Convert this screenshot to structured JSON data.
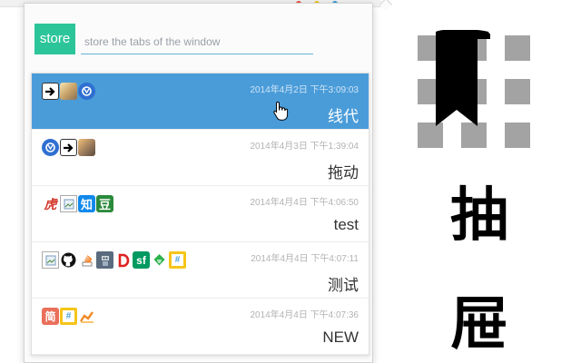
{
  "popup": {
    "store_label": "store",
    "name_placeholder": "store the tabs of the window"
  },
  "tab_groups": [
    {
      "time": "2014年4月2日 下午3:09:03",
      "title": "线代",
      "selected": true
    },
    {
      "time": "2014年4月3日 下午1:39:04",
      "title": "拖动",
      "selected": false
    },
    {
      "time": "2014年4月4日 下午4:06:50",
      "title": "test",
      "selected": false
    },
    {
      "time": "2014年4月4日 下午4:07:11",
      "title": "测试",
      "selected": false
    },
    {
      "time": "2014年4月4日 下午4:07:36",
      "title": "NEW",
      "selected": false
    }
  ],
  "favicons": {
    "row0": [
      "arrow-favicon",
      "anime-favicon",
      "app-favicon"
    ],
    "row1": [
      "app-favicon",
      "arrow-favicon",
      "anime-favicon"
    ],
    "row2": [
      "tiger-favicon",
      "broken-image-favicon",
      "zhihu-favicon",
      "douban-favicon"
    ],
    "row3": [
      "broken-image-favicon",
      "github-favicon",
      "stack-favicon",
      "robot-favicon",
      "d-favicon",
      "segmentfault-favicon",
      "feedly-favicon",
      "hash-favicon"
    ],
    "row4": [
      "jian-favicon",
      "hash-favicon",
      "chart-favicon"
    ]
  },
  "favicon_text": {
    "zhihu": "知",
    "douban": "豆",
    "segmentfault": "sf",
    "jian": "简",
    "tiger": "虎"
  },
  "logo": {
    "char_top": "抽",
    "char_bottom": "屉"
  },
  "colors": {
    "accent_green": "#2cc59a",
    "selected_blue": "#4a9cd9"
  }
}
